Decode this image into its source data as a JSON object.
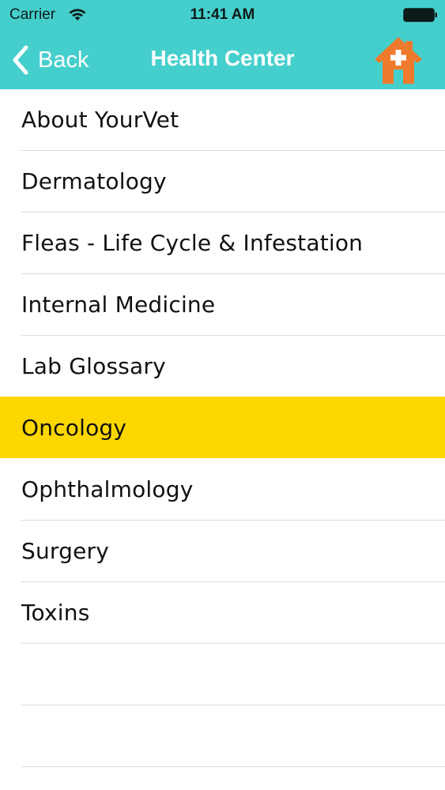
{
  "status_bar": {
    "carrier": "Carrier",
    "time": "11:41 AM",
    "wifi_icon": "wifi-icon",
    "battery_icon": "battery-icon"
  },
  "nav": {
    "back_label": "Back",
    "title": "Health Center",
    "home_icon": "home-plus-icon"
  },
  "colors": {
    "header": "#45cfcc",
    "selected_row": "#fed700",
    "home_icon": "#ef7a2c"
  },
  "menu": {
    "items": [
      {
        "label": "About YourVet"
      },
      {
        "label": "Dermatology"
      },
      {
        "label": "Fleas - Life Cycle & Infestation"
      },
      {
        "label": "Internal Medicine"
      },
      {
        "label": "Lab Glossary"
      },
      {
        "label": "Oncology",
        "selected": true
      },
      {
        "label": "Ophthalmology"
      },
      {
        "label": "Surgery"
      },
      {
        "label": "Toxins"
      }
    ]
  }
}
